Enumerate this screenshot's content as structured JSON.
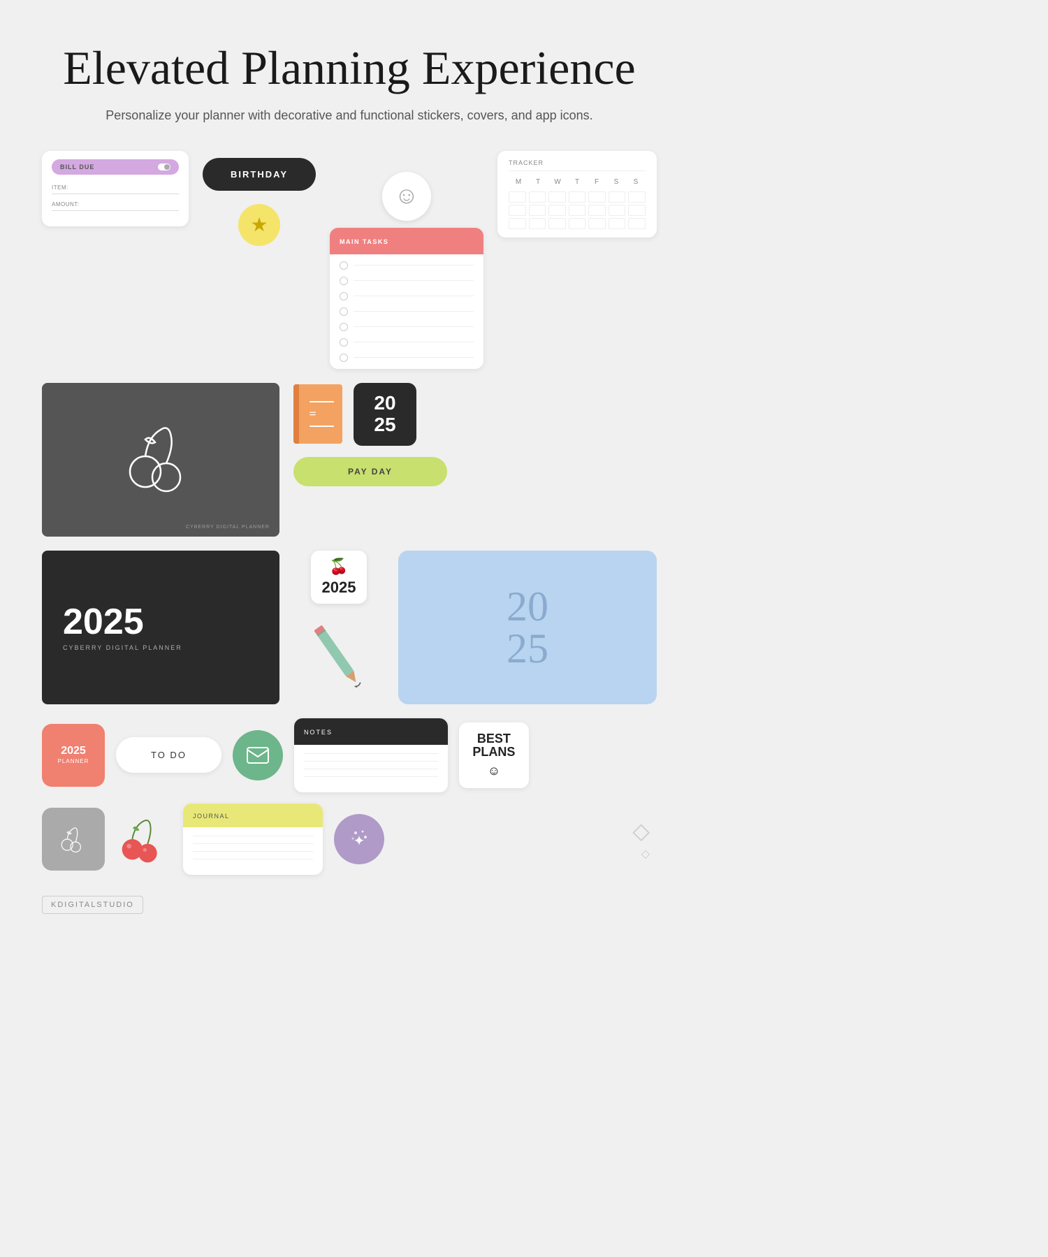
{
  "header": {
    "title": "Elevated Planning Experience",
    "subtitle": "Personalize your planner with decorative and functional stickers, covers, and app icons."
  },
  "bill_due": {
    "label": "BILL DUE",
    "item_label": "ITEM:",
    "amount_label": "AMOUNT:"
  },
  "birthday": {
    "label": "BIRTHDAY"
  },
  "star": {
    "symbol": "★"
  },
  "tracker": {
    "label": "TRACKER",
    "days": [
      "M",
      "T",
      "W",
      "T",
      "F",
      "S",
      "S"
    ]
  },
  "smiley": {
    "symbol": "☺"
  },
  "main_tasks": {
    "label": "MAIN TASKS",
    "item_count": 7
  },
  "cherry_cover": {
    "watermark": "CYBERRY DIGITAL PLANNER"
  },
  "notebook": {
    "symbol": "="
  },
  "badge_2025": {
    "line1": "20",
    "line2": "25"
  },
  "payday": {
    "label": "PAY DAY"
  },
  "cover_2025_dark": {
    "year": "2025",
    "subtitle": "CYBERRY DIGITAL PLANNER"
  },
  "sticker_2025": {
    "cherry": "🍒",
    "year": "2025"
  },
  "cover_blue": {
    "line1": "20",
    "line2": "25"
  },
  "app_planner": {
    "year": "2025",
    "label": "PLANNER"
  },
  "todo": {
    "label": "TO DO"
  },
  "notes": {
    "label": "NOTES",
    "line_count": 4
  },
  "best_plans": {
    "text": "BEST PLANS",
    "emoji": "☺"
  },
  "journal": {
    "label": "JOURNAL",
    "line_count": 4
  },
  "footer": {
    "brand": "KDIGITALSTUDIO"
  },
  "diamonds": {
    "large": "◇",
    "small": "◇"
  }
}
